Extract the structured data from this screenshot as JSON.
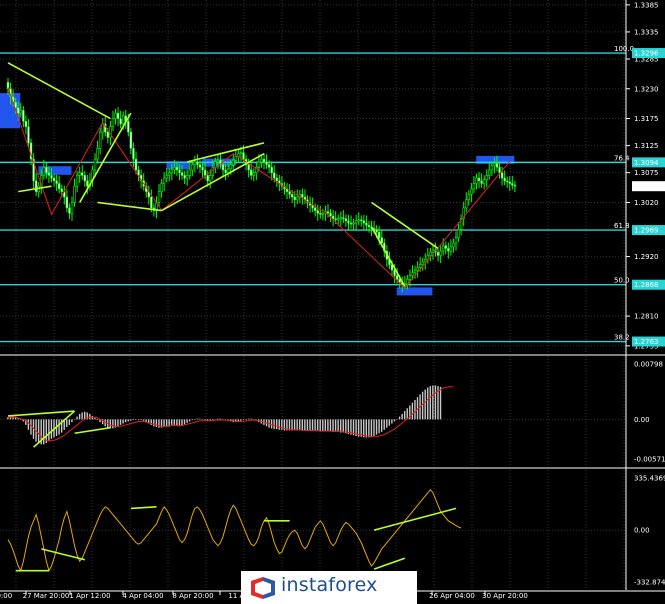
{
  "chart_data": [
    {
      "type": "candlestick",
      "panel": "price",
      "ylim": [
        1.274,
        1.3394
      ],
      "y_ticks": [
        "1.3385",
        "1.3335",
        "1.3285",
        "1.3230",
        "1.3175",
        "1.3125",
        "1.3075",
        "1.3020",
        "1.2920",
        "1.2810",
        "1.2755"
      ],
      "x_ticks": [
        "27 Mar 20:00",
        "1 Apr 12:00",
        "4 Apr 04:00",
        "8 Apr 20:00",
        "11 Apr",
        "26 Apr 04:00",
        "30 Apr 20:00"
      ],
      "current_price": "1.3050",
      "levels": [
        {
          "label": "100.0",
          "price": "1.3296",
          "value": 1.3296
        },
        {
          "label": "76.4",
          "price": "1.3094",
          "value": 1.3094
        },
        {
          "label": "61.8",
          "price": "1.2969",
          "value": 1.2969
        },
        {
          "label": "50.0",
          "price": "1.2868",
          "value": 1.2868
        },
        {
          "label": "38.2",
          "price": "1.2763",
          "value": 1.2763
        }
      ],
      "zones": [
        {
          "x0": 0,
          "x1": 4,
          "y0": 1.3157,
          "y1": 1.3222
        },
        {
          "x0": 15,
          "x1": 24,
          "y0": 1.3071,
          "y1": 1.3087
        },
        {
          "x0": 65,
          "x1": 70,
          "y0": 1.3083,
          "y1": 1.3096
        },
        {
          "x0": 79,
          "x1": 88,
          "y0": 1.3088,
          "y1": 1.3101
        },
        {
          "x0": 186,
          "x1": 197,
          "y0": 1.3092,
          "y1": 1.3106
        },
        {
          "x0": 155,
          "x1": 165,
          "y0": 1.285,
          "y1": 1.2863
        }
      ],
      "close": [
        1.323,
        1.3215,
        1.3205,
        1.3195,
        1.3185,
        1.319,
        1.317,
        1.316,
        1.313,
        1.31,
        1.306,
        1.304,
        1.305,
        1.307,
        1.3085,
        1.3075,
        1.307,
        1.3065,
        1.306,
        1.3055,
        1.3045,
        1.304,
        1.303,
        1.301,
        1.3,
        1.302,
        1.305,
        1.307,
        1.3075,
        1.307,
        1.306,
        1.305,
        1.306,
        1.308,
        1.31,
        1.312,
        1.315,
        1.3165,
        1.315,
        1.314,
        1.316,
        1.3175,
        1.3185,
        1.3175,
        1.3165,
        1.318,
        1.317,
        1.315,
        1.312,
        1.31,
        1.308,
        1.307,
        1.306,
        1.305,
        1.304,
        1.303,
        1.301,
        1.3005,
        1.302,
        1.304,
        1.3055,
        1.3065,
        1.307,
        1.3075,
        1.308,
        1.3085,
        1.308,
        1.3075,
        1.307,
        1.3065,
        1.307,
        1.308,
        1.309,
        1.3095,
        1.309,
        1.3085,
        1.308,
        1.307,
        1.306,
        1.307,
        1.3085,
        1.3095,
        1.3098,
        1.309,
        1.308,
        1.3075,
        1.3082,
        1.309,
        1.3098,
        1.3105,
        1.311,
        1.3112,
        1.31,
        1.309,
        1.308,
        1.307,
        1.3075,
        1.3085,
        1.3095,
        1.31,
        1.3095,
        1.309,
        1.3085,
        1.3075,
        1.3065,
        1.306,
        1.3055,
        1.305,
        1.3045,
        1.304,
        1.3035,
        1.303,
        1.3025,
        1.303,
        1.3035,
        1.303,
        1.3025,
        1.302,
        1.3015,
        1.301,
        1.3005,
        1.3,
        1.2998,
        1.3,
        1.3003,
        1.3,
        1.2995,
        1.299,
        1.2988,
        1.299,
        1.2992,
        1.299,
        1.2986,
        1.2982,
        1.298,
        1.2982,
        1.2986,
        1.2988,
        1.2986,
        1.2982,
        1.2978,
        1.2975,
        1.2972,
        1.297,
        1.2965,
        1.2955,
        1.2945,
        1.293,
        1.2915,
        1.2905,
        1.2895,
        1.2885,
        1.2878,
        1.2872,
        1.2868,
        1.287,
        1.2878,
        1.2885,
        1.289,
        1.2895,
        1.29,
        1.2905,
        1.291,
        1.2915,
        1.2922,
        1.2928,
        1.2932,
        1.2928,
        1.2922,
        1.293,
        1.294,
        1.2935,
        1.293,
        1.2938,
        1.2945,
        1.2955,
        1.297,
        1.299,
        1.301,
        1.3025,
        1.3035,
        1.3045,
        1.3055,
        1.3065,
        1.306,
        1.3055,
        1.3062,
        1.307,
        1.308,
        1.3088,
        1.3092,
        1.3085,
        1.3075,
        1.3065,
        1.306,
        1.3058,
        1.3055,
        1.3052,
        1.305
      ],
      "zigzag": [
        [
          0,
          1.3232
        ],
        [
          17,
          1.2998
        ],
        [
          37,
          1.3168
        ],
        [
          60,
          1.3005
        ],
        [
          88,
          1.311
        ],
        [
          125,
          1.2997
        ],
        [
          155,
          1.2862
        ],
        [
          196,
          1.3096
        ]
      ],
      "trendlines": [
        [
          0,
          1.3278,
          40,
          1.3175
        ],
        [
          4,
          1.304,
          17,
          1.305
        ],
        [
          28,
          1.302,
          48,
          1.3185
        ],
        [
          35,
          1.302,
          60,
          1.3005
        ],
        [
          70,
          1.3095,
          100,
          1.313
        ],
        [
          60,
          1.3005,
          100,
          1.311
        ],
        [
          142,
          1.302,
          168,
          1.2935
        ],
        [
          142,
          1.2975,
          155,
          1.2865
        ]
      ]
    },
    {
      "type": "histogram",
      "panel": "oscillator",
      "ylim": [
        -0.00571,
        0.00798
      ],
      "y_ticks": [
        "0.00798",
        "0.00",
        "-0.00571"
      ],
      "bars": [
        0.0003,
        0.0004,
        0.0004,
        0.0003,
        0.0002,
        0.0,
        -0.0003,
        -0.0008,
        -0.0015,
        -0.0022,
        -0.0028,
        -0.0032,
        -0.0035,
        -0.0036,
        -0.0036,
        -0.0034,
        -0.0031,
        -0.0028,
        -0.0026,
        -0.0024,
        -0.0022,
        -0.0019,
        -0.0015,
        -0.0011,
        -0.0008,
        -0.0004,
        0.0,
        0.0004,
        0.0008,
        0.001,
        0.0011,
        0.001,
        0.0008,
        0.0005,
        0.0002,
        -0.0001,
        -0.0004,
        -0.0007,
        -0.001,
        -0.0012,
        -0.0013,
        -0.0013,
        -0.0012,
        -0.001,
        -0.0008,
        -0.0006,
        -0.0004,
        -0.0003,
        -0.0002,
        -0.0001,
        0.0,
        0.0,
        -0.0001,
        -0.0002,
        -0.0004,
        -0.0006,
        -0.0008,
        -0.001,
        -0.0011,
        -0.0012,
        -0.0012,
        -0.0011,
        -0.001,
        -0.0009,
        -0.0008,
        -0.0008,
        -0.0009,
        -0.001,
        -0.0009,
        -0.0007,
        -0.0005,
        -0.0003,
        -0.0001,
        0.0,
        0.0001,
        0.0001,
        0.0,
        -0.0001,
        -0.0002,
        -0.0002,
        -0.0001,
        0.0,
        0.0001,
        0.0001,
        0.0,
        -0.0001,
        -0.0002,
        -0.0003,
        -0.0004,
        -0.0004,
        -0.0003,
        -0.0002,
        -0.0001,
        0.0,
        0.0001,
        0.0001,
        0.0,
        -0.0002,
        -0.0004,
        -0.0006,
        -0.0008,
        -0.001,
        -0.0012,
        -0.0013,
        -0.0014,
        -0.0014,
        -0.0015,
        -0.0015,
        -0.0016,
        -0.0016,
        -0.0016,
        -0.0016,
        -0.0016,
        -0.0016,
        -0.0016,
        -0.0016,
        -0.0016,
        -0.0017,
        -0.0017,
        -0.0017,
        -0.0017,
        -0.0017,
        -0.0017,
        -0.0017,
        -0.0017,
        -0.0017,
        -0.0017,
        -0.0018,
        -0.0018,
        -0.0018,
        -0.0019,
        -0.0019,
        -0.002,
        -0.0021,
        -0.0022,
        -0.0023,
        -0.0024,
        -0.0025,
        -0.0025,
        -0.0026,
        -0.0026,
        -0.0026,
        -0.0025,
        -0.0024,
        -0.0022,
        -0.002,
        -0.0018,
        -0.0015,
        -0.0012,
        -0.0009,
        -0.0006,
        -0.0003,
        0.0,
        0.0004,
        0.0008,
        0.0012,
        0.0016,
        0.002,
        0.0024,
        0.0028,
        0.0032,
        0.0036,
        0.004,
        0.0043,
        0.0046,
        0.0048,
        0.0049,
        0.0049,
        0.0048,
        0.0047
      ],
      "signal": [
        0.0002,
        0.0003,
        0.0003,
        0.0003,
        0.0002,
        0.0001,
        0.0,
        -0.0002,
        -0.0005,
        -0.0009,
        -0.0013,
        -0.0017,
        -0.0021,
        -0.0025,
        -0.0028,
        -0.003,
        -0.0031,
        -0.0031,
        -0.003,
        -0.0029,
        -0.0027,
        -0.0025,
        -0.0023,
        -0.002,
        -0.0017,
        -0.0014,
        -0.0011,
        -0.0008,
        -0.0005,
        -0.0002,
        0.0,
        0.0002,
        0.0003,
        0.0003,
        0.0003,
        0.0002,
        0.0,
        -0.0002,
        -0.0004,
        -0.0006,
        -0.0008,
        -0.0009,
        -0.001,
        -0.001,
        -0.001,
        -0.0009,
        -0.0008,
        -0.0007,
        -0.0006,
        -0.0005,
        -0.0004,
        -0.0003,
        -0.0003,
        -0.0003,
        -0.0004,
        -0.0005,
        -0.0006,
        -0.0007,
        -0.0008,
        -0.0009,
        -0.001,
        -0.001,
        -0.001,
        -0.001,
        -0.0009,
        -0.0009,
        -0.0009,
        -0.0009,
        -0.0009,
        -0.0008,
        -0.0007,
        -0.0006,
        -0.0005,
        -0.0004,
        -0.0003,
        -0.0002,
        -0.0002,
        -0.0002,
        -0.0002,
        -0.0002,
        -0.0002,
        -0.0001,
        -0.0001,
        -0.0001,
        -0.0001,
        -0.0001,
        -0.0001,
        -0.0002,
        -0.0002,
        -0.0003,
        -0.0003,
        -0.0003,
        -0.0003,
        -0.0002,
        -0.0002,
        -0.0001,
        -0.0001,
        -0.0001,
        -0.0002,
        -0.0003,
        -0.0004,
        -0.0005,
        -0.0006,
        -0.0008,
        -0.0009,
        -0.001,
        -0.0011,
        -0.0012,
        -0.0013,
        -0.0014,
        -0.0014,
        -0.0015,
        -0.0015,
        -0.0015,
        -0.0015,
        -0.0016,
        -0.0016,
        -0.0016,
        -0.0016,
        -0.0016,
        -0.0016,
        -0.0016,
        -0.0017,
        -0.0017,
        -0.0017,
        -0.0017,
        -0.0017,
        -0.0017,
        -0.0017,
        -0.0017,
        -0.0017,
        -0.0018,
        -0.0018,
        -0.0019,
        -0.0019,
        -0.002,
        -0.0021,
        -0.0022,
        -0.0022,
        -0.0023,
        -0.0024,
        -0.0024,
        -0.0025,
        -0.0025,
        -0.0025,
        -0.0024,
        -0.0023,
        -0.0022,
        -0.002,
        -0.0018,
        -0.0016,
        -0.0014,
        -0.0011,
        -0.0008,
        -0.0005,
        -0.0002,
        0.0001,
        0.0004,
        0.0008,
        0.0011,
        0.0015,
        0.0018,
        0.0022,
        0.0025,
        0.0029,
        0.0032,
        0.0035,
        0.0038,
        0.0041,
        0.0043,
        0.0045,
        0.0046,
        0.0047,
        0.0047,
        0.0047
      ],
      "trendlines": [
        [
          0,
          0.0005,
          26,
          0.0012
        ],
        [
          10,
          -0.004,
          26,
          0.0012
        ],
        [
          26,
          -0.002,
          40,
          -0.0012
        ]
      ]
    },
    {
      "type": "line",
      "panel": "oscillator",
      "ylim": [
        -332.874,
        335.4369
      ],
      "y_ticks": [
        "335.4369",
        "0.00",
        "-332.874"
      ],
      "values": [
        -60,
        -90,
        -130,
        -180,
        -230,
        -260,
        -200,
        -120,
        -40,
        20,
        60,
        100,
        40,
        -40,
        -120,
        -200,
        -260,
        -230,
        -180,
        -120,
        -60,
        20,
        80,
        120,
        60,
        -20,
        -100,
        -160,
        -200,
        -180,
        -140,
        -100,
        -60,
        -20,
        20,
        60,
        100,
        130,
        150,
        140,
        120,
        100,
        80,
        60,
        40,
        20,
        0,
        -20,
        -40,
        -60,
        -80,
        -90,
        -80,
        -60,
        -40,
        -20,
        0,
        20,
        40,
        80,
        120,
        150,
        130,
        100,
        60,
        20,
        -20,
        -60,
        -80,
        -60,
        -20,
        40,
        100,
        140,
        150,
        130,
        100,
        60,
        20,
        -20,
        -60,
        -80,
        -100,
        -80,
        -40,
        20,
        80,
        130,
        160,
        140,
        100,
        60,
        20,
        -20,
        -60,
        -90,
        -100,
        -80,
        -40,
        20,
        60,
        80,
        40,
        -20,
        -80,
        -120,
        -150,
        -140,
        -100,
        -60,
        -30,
        -10,
        0,
        -20,
        -60,
        -100,
        -120,
        -100,
        -60,
        -20,
        20,
        40,
        60,
        40,
        0,
        -40,
        -80,
        -100,
        -80,
        -40,
        0,
        30,
        50,
        40,
        20,
        0,
        -20,
        -50,
        -80,
        -120,
        -160,
        -200,
        -230,
        -210,
        -180,
        -150,
        -120,
        -100,
        -80,
        -60,
        -40,
        -20,
        0,
        20,
        40,
        60,
        80,
        100,
        120,
        140,
        160,
        180,
        200,
        220,
        240,
        260,
        240,
        200,
        160,
        120,
        100,
        80,
        60,
        50,
        40,
        30,
        20,
        15
      ],
      "trendlines": [
        [
          3,
          -260,
          16,
          -260
        ],
        [
          13,
          -120,
          30,
          -190
        ],
        [
          48,
          140,
          58,
          150
        ],
        [
          100,
          60,
          110,
          60
        ],
        [
          143,
          -250,
          155,
          -180
        ],
        [
          143,
          0,
          175,
          140
        ]
      ]
    }
  ],
  "watermark": "instaforex"
}
